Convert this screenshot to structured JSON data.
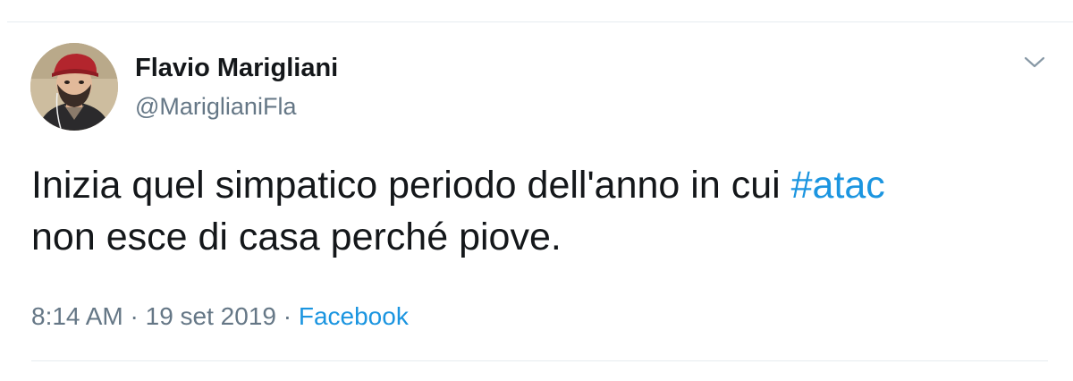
{
  "author": {
    "name": "Flavio Marigliani",
    "handle": "@MariglianiFla"
  },
  "tweet": {
    "text_line1_before": "Inizia quel simpatico periodo dell'anno in cui ",
    "hashtag": "#atac",
    "text_line2": "non esce di casa perché piove."
  },
  "meta": {
    "time": "8:14 AM",
    "separator1": " · ",
    "date": "19 set 2019",
    "separator2": " · ",
    "source": "Facebook"
  },
  "icons": {
    "menu": "chevron-down-icon",
    "avatar": "user-avatar"
  },
  "colors": {
    "link": "#1b95e0",
    "secondary_text": "#657786",
    "primary_text": "#14171a",
    "divider": "#e6ecf0"
  }
}
